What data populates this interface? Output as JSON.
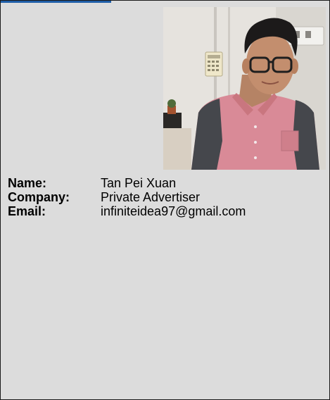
{
  "profile": {
    "name_label": "Name:",
    "name": "Tan Pei Xuan",
    "company_label": "Company:",
    "company": "Private Advertiser",
    "email_label": "Email:",
    "email": "infiniteidea97@gmail.com"
  },
  "colors": {
    "card_background": "#dcdcdc",
    "accent": "#1f5ea8",
    "border": "#1a1a1a"
  }
}
